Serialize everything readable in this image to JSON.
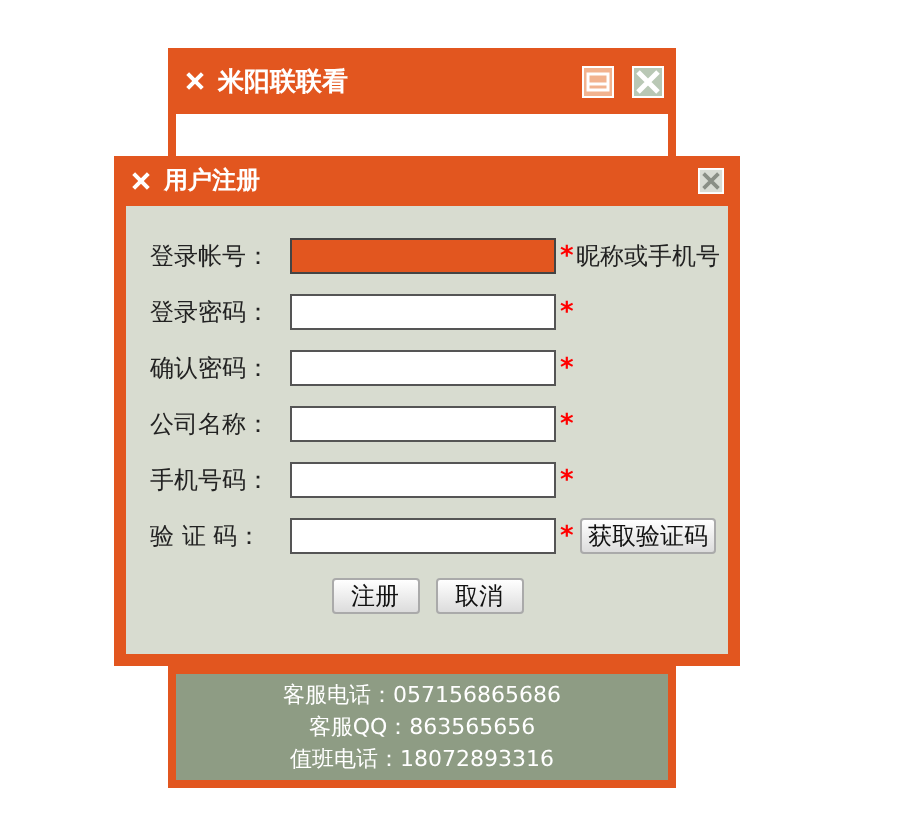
{
  "main_window": {
    "title": "米阳联联看",
    "footer_lines": [
      "客服电话：057156865686",
      "客服QQ：863565656",
      "值班电话：18072893316"
    ]
  },
  "dialog": {
    "title": "用户注册",
    "fields": [
      {
        "label": "登录帐号：",
        "focused": true,
        "mark": "*",
        "hint": "昵称或手机号"
      },
      {
        "label": "登录密码：",
        "focused": false,
        "mark": "*"
      },
      {
        "label": "确认密码：",
        "focused": false,
        "mark": "*"
      },
      {
        "label": "公司名称：",
        "focused": false,
        "mark": "*"
      },
      {
        "label": "手机号码：",
        "focused": false,
        "mark": "*"
      },
      {
        "label": "验 证 码：",
        "focused": false,
        "mark": "*",
        "button": "获取验证码"
      }
    ],
    "buttons": [
      "注册",
      "取消"
    ]
  }
}
